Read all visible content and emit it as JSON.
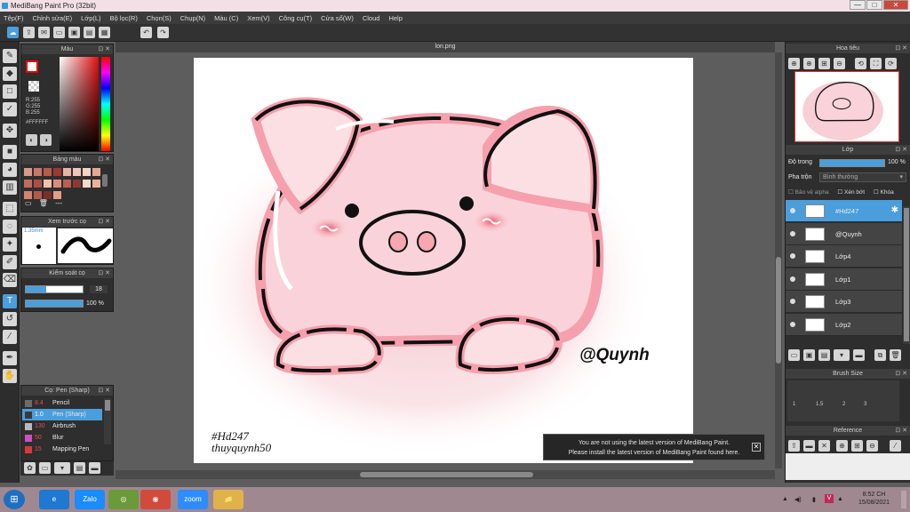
{
  "title": "MediBang Paint Pro (32bit)",
  "window_buttons": {
    "minimize": "—",
    "maximize": "□",
    "close": "✕"
  },
  "menu": [
    "Tệp(F)",
    "Chỉnh sửa(E)",
    "Lớp(L)",
    "Bộ lọc(R)",
    "Chọn(S)",
    "Chụp(N)",
    "Màu (C)",
    "Xem(V)",
    "Công cụ(T)",
    "Cửa sổ(W)",
    "Cloud",
    "Help"
  ],
  "panels": {
    "color": {
      "title": "Màu",
      "rgb_r": "R:255",
      "rgb_g": "G:255",
      "rgb_b": "B:255",
      "hex": "#FFFFFF"
    },
    "palette": {
      "title": "Bảng màu",
      "menu_label": "---"
    },
    "preview": {
      "title": "Xem trước cọ",
      "size": "1.35mm"
    },
    "control": {
      "title": "Kiểm soát cọ",
      "size_value": "18",
      "opacity_value": "100 %"
    },
    "brush": {
      "title": "Cọ: Pen (Sharp)",
      "items": [
        {
          "size": "8.4",
          "name": "Pencil",
          "color": "#6b6b6b"
        },
        {
          "size": "1.0",
          "name": "Pen (Sharp)",
          "color": "#3a3a3a"
        },
        {
          "size": "130",
          "name": "Airbrush",
          "color": "#b9b9b9"
        },
        {
          "size": "50",
          "name": "Blur",
          "color": "#d14fc2"
        },
        {
          "size": "15",
          "name": "Mapping Pen",
          "color": "#d83a3a"
        }
      ]
    },
    "navigator": {
      "title": "Hoa tiêu"
    },
    "layers": {
      "title": "Lớp",
      "opacity_label": "Độ trong",
      "opacity_value": "100 %",
      "blend_label": "Pha trộn",
      "blend_value": "Bình thường",
      "protect_alpha": "Bảo vệ alpha",
      "clipping": "Xén bớt",
      "lock": "Khóa",
      "items": [
        {
          "name": "#Hd247",
          "selected": true
        },
        {
          "name": "@Quynh",
          "selected": false
        },
        {
          "name": "Lớp4",
          "selected": false
        },
        {
          "name": "Lớp1",
          "selected": false
        },
        {
          "name": "Lớp3",
          "selected": false
        },
        {
          "name": "Lớp2",
          "selected": false
        }
      ]
    },
    "brush_size": {
      "title": "Brush Size",
      "labels": [
        "1",
        "1.5",
        "2",
        "3"
      ]
    },
    "reference": {
      "title": "Reference"
    }
  },
  "document": {
    "tab": "lon.png"
  },
  "artwork": {
    "signature": "@Quynh",
    "tag": "#Hd247",
    "credit": "thuyquynh50"
  },
  "notice": {
    "line1": "You are not using the latest version of MediBang Paint.",
    "line2": "Please install the latest version of MediBang Paint found here."
  },
  "taskbar": {
    "time": "8:52 CH",
    "date": "15/08/2021",
    "apps": [
      "e",
      "Zalo",
      "◎",
      "◉",
      "zoom",
      "📁"
    ]
  },
  "colors": {
    "accent": "#4a9edb",
    "pig_pink": "#f7b7bf",
    "pig_outline": "#111111"
  }
}
